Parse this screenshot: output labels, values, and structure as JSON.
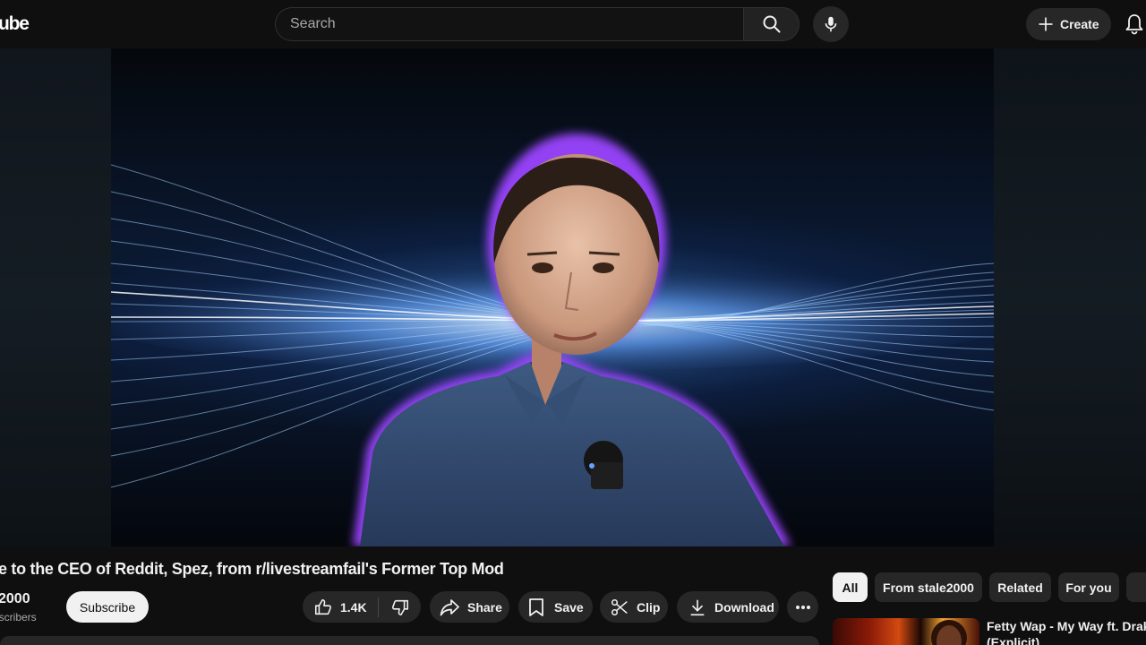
{
  "header": {
    "logo_text": "ube",
    "search_placeholder": "Search",
    "create_label": "Create"
  },
  "video": {
    "title": "e to the CEO of Reddit, Spez, from r/livestreamfail's Former Top Mod"
  },
  "channel": {
    "name": "2000",
    "subscribers": "bscribers",
    "subscribe_label": "Subscribe"
  },
  "actions": {
    "like_count": "1.4K",
    "share_label": "Share",
    "save_label": "Save",
    "clip_label": "Clip",
    "download_label": "Download"
  },
  "chips": [
    "All",
    "From stale2000",
    "Related",
    "For you"
  ],
  "recommendation": {
    "title_line1": "Fetty Wap - My Way ft. Drake",
    "title_line2": "(Explicit)"
  },
  "colors": {
    "background": "#0f0f0f",
    "surface": "#272727",
    "text": "#f1f1f1",
    "muted_text": "#aaaaaa",
    "subscribe_bg": "#f1f1f1",
    "glow_purple": "#a24bff",
    "shirt_blue": "#3a5378"
  },
  "icons": {
    "search": "search-icon",
    "mic": "mic-icon",
    "create": "plus-icon",
    "notifications": "bell-icon",
    "like": "thumbs-up-icon",
    "dislike": "thumbs-down-icon",
    "share": "share-arrow-icon",
    "save": "bookmark-icon",
    "clip": "scissors-icon",
    "download": "download-icon",
    "more": "more-horizontal-icon"
  }
}
